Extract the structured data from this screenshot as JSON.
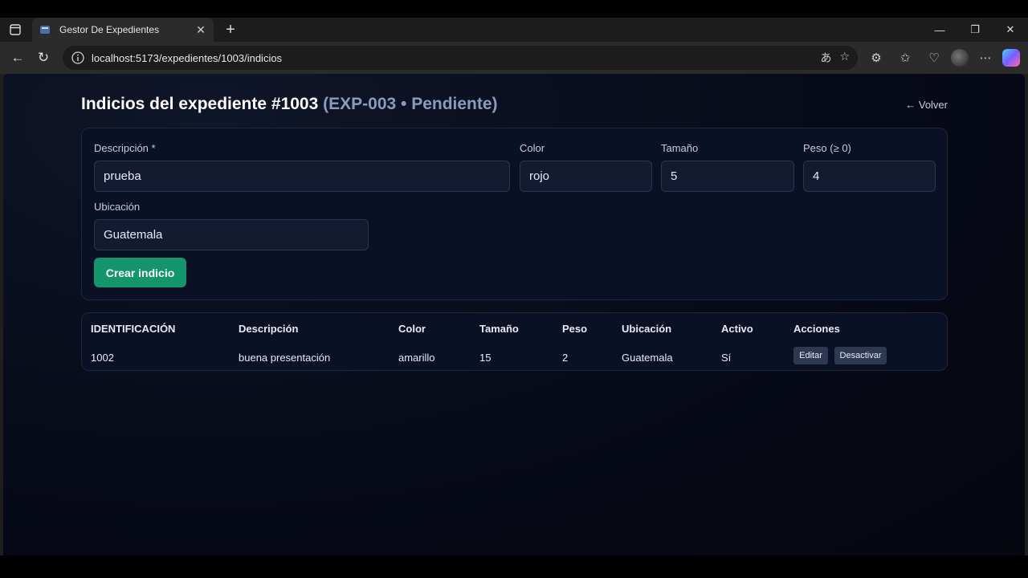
{
  "browser": {
    "tab_title": "Gestor De Expedientes",
    "url": "localhost:5173/expedientes/1003/indicios"
  },
  "header": {
    "title": "Indicios del expediente #1003",
    "subtitle": "(EXP-003 • Pendiente)",
    "back_label": "← Volver"
  },
  "form": {
    "descripcion_label": "Descripción *",
    "descripcion_value": "prueba",
    "color_label": "Color",
    "color_value": "rojo",
    "tamano_label": "Tamaño",
    "tamano_value": "5",
    "peso_label": "Peso (≥ 0)",
    "peso_value": "4",
    "ubicacion_label": "Ubicación",
    "ubicacion_value": "Guatemala",
    "submit_label": "Crear indicio"
  },
  "table": {
    "columns": [
      "IDENTIFICACIÓN",
      "Descripción",
      "Color",
      "Tamaño",
      "Peso",
      "Ubicación",
      "Activo",
      "Acciones"
    ],
    "rows": [
      {
        "id": "1002",
        "descripcion": "buena presentación",
        "color": "amarillo",
        "tamano": "15",
        "peso": "2",
        "ubicacion": "Guatemala",
        "activo": "Sí",
        "edit_label": "Editar",
        "deactivate_label": "Desactivar"
      }
    ]
  },
  "colors": {
    "accent": "#14956b",
    "background": "#070a18",
    "subtitle": "#8c9bbd"
  }
}
